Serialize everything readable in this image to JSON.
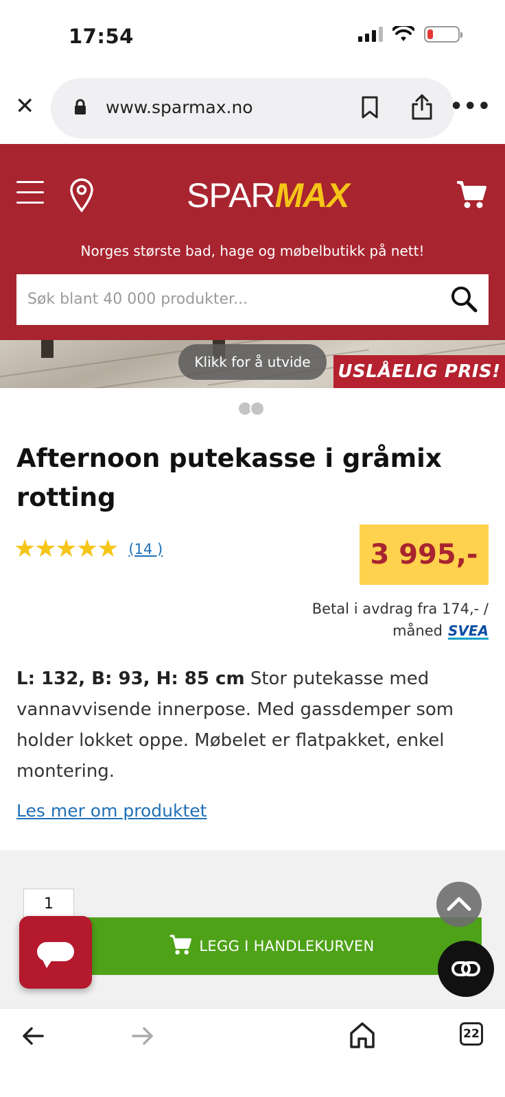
{
  "status_bar": {
    "time": "17:54"
  },
  "browser": {
    "url": "www.sparmax.no",
    "tab_count": "22"
  },
  "header": {
    "logo_spar": "SPAR",
    "logo_max": "MAX",
    "tagline": "Norges største bad, hage og møbelbutikk på nett!",
    "search_placeholder": "Søk blant 40 000 produkter..."
  },
  "banner": {
    "expand_label": "Klikk for å utvide",
    "promo": "USLÅELIG PRIS!"
  },
  "product": {
    "title": "Afternoon putekasse i gråmix rotting",
    "stars": "★★★★★",
    "rating_value": 5,
    "review_count": "(14 )",
    "price": "3 995,-",
    "installment_line1": "Betal i avdrag fra 174,- /",
    "installment_line2": "måned",
    "installment_provider": "SVEA",
    "dimensions": "L: 132, B: 93, H: 85 cm",
    "description": "Stor putekasse med vannavvisende innerpose. Med gassdemper som holder lokket oppe. Møbelet er flatpakket, enkel montering.",
    "read_more": "Les mer om produktet"
  },
  "cart": {
    "quantity": "1",
    "add_button": "LEGG I HANDLEKURVEN"
  },
  "colors": {
    "brand_red": "#a8242f",
    "price_yellow": "#ffd24d",
    "cta_green": "#4ea218",
    "link_blue": "#1f6fb5"
  },
  "icons": [
    "close-icon",
    "lock-icon",
    "bookmark-icon",
    "share-icon",
    "more-icon",
    "hamburger-icon",
    "location-icon",
    "cart-icon",
    "search-icon",
    "chat-icon",
    "chevron-up-icon",
    "back-icon",
    "forward-icon",
    "home-icon",
    "tabs-icon"
  ]
}
